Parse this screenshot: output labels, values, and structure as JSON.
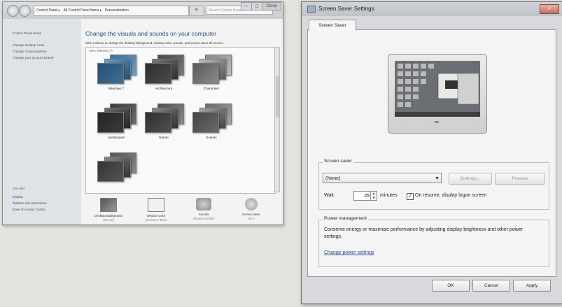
{
  "personalization": {
    "address": [
      "Control Panel",
      "All Control Panel Items",
      "Personalization"
    ],
    "search_placeholder": "Search Control Panel",
    "window_controls": [
      "—",
      "▢",
      "Close"
    ],
    "sidebar": {
      "links": [
        "Control Panel Home",
        "Change desktop icons",
        "Change mouse pointers",
        "Change your account picture"
      ],
      "see_also_title": "See also",
      "see_also": [
        "Display",
        "Taskbar and Start Menu",
        "Ease of Access Center"
      ]
    },
    "heading": "Change the visuals and sounds on your computer",
    "subheading": "Click a theme to change the desktop background, window color, sounds, and screen saver all at once.",
    "group_label": "Aero Themes (7)",
    "themes": [
      {
        "name": "Windows 7",
        "colors": [
          "#3d6f9b",
          "#6aa0c8",
          "#2a4d70"
        ]
      },
      {
        "name": "Architecture",
        "colors": [
          "#4a4a4a",
          "#7a7a7a",
          "#2e2e2e"
        ]
      },
      {
        "name": "Characters",
        "colors": [
          "#8a8a8a",
          "#bdbdbd",
          "#5a5a5a"
        ]
      },
      {
        "name": "Landscapes",
        "colors": [
          "#3b3b3b",
          "#6d6d6d",
          "#252525"
        ]
      },
      {
        "name": "Nature",
        "colors": [
          "#505050",
          "#8c8c8c",
          "#2f2f2f"
        ]
      },
      {
        "name": "Scenes",
        "colors": [
          "#6a6a6a",
          "#a4a4a4",
          "#444444"
        ]
      },
      {
        "name": "",
        "colors": [
          "#555555",
          "#8a8a8a",
          "#333333"
        ]
      }
    ],
    "bottom": [
      {
        "title": "Desktop Background",
        "sub": "Harmony"
      },
      {
        "title": "Window Color",
        "sub": "Windows 7 Basic"
      },
      {
        "title": "Sounds",
        "sub": "Windows Default"
      },
      {
        "title": "Screen Saver",
        "sub": "None"
      }
    ]
  },
  "screen_saver_settings": {
    "title": "Screen Saver Settings",
    "close_label": "✕",
    "tab": "Screen Saver",
    "group_label": "Screen saver",
    "selected": "(None)",
    "settings_button": "Settings...",
    "preview_button": "Preview",
    "wait_label": "Wait:",
    "wait_value": "25",
    "minutes_label": "minutes",
    "resume_checked": true,
    "resume_label": "On resume, display logon screen",
    "power_group_label": "Power management",
    "power_text": "Conserve energy or maximize performance by adjusting display brightness and other power settings.",
    "power_link": "Change power settings",
    "ok": "OK",
    "cancel": "Cancel",
    "apply": "Apply"
  }
}
